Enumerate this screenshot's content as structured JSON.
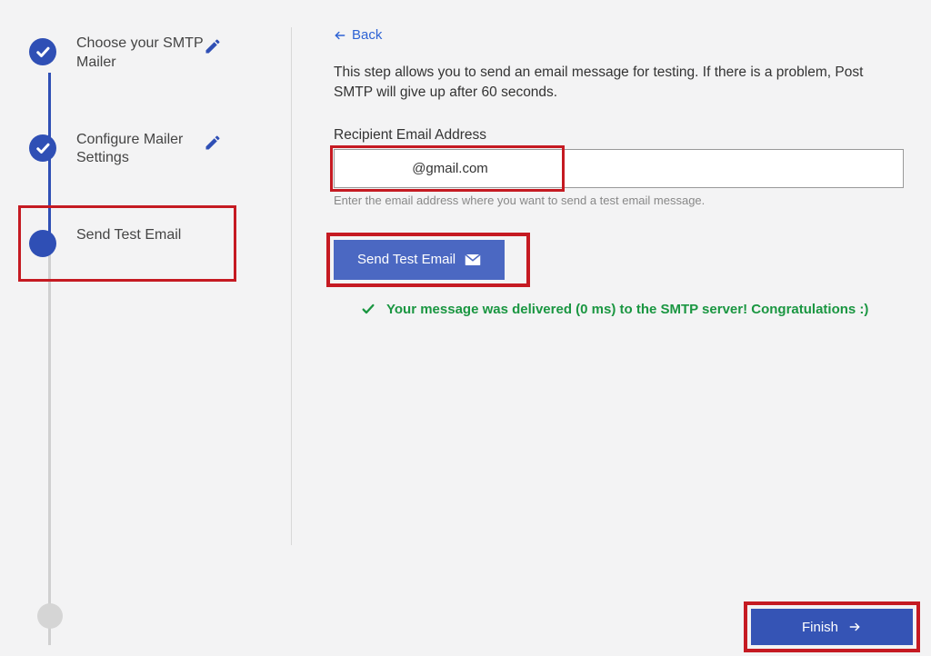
{
  "sidebar": {
    "steps": [
      {
        "label": "Choose your SMTP Mailer",
        "editable": true,
        "completed": true
      },
      {
        "label": "Configure Mailer Settings",
        "editable": true,
        "completed": true
      },
      {
        "label": "Send Test Email",
        "editable": false,
        "completed": false,
        "current": true
      }
    ]
  },
  "main": {
    "back_label": "Back",
    "description": "This step allows you to send an email message for testing. If there is a problem, Post SMTP will give up after 60 seconds.",
    "field_label": "Recipient Email Address",
    "input_value": "@gmail.com",
    "helper_text": "Enter the email address where you want to send a test email message.",
    "send_button_label": "Send Test Email",
    "success_message": "Your message was delivered (0 ms) to the SMTP server! Congratulations :)"
  },
  "footer": {
    "finish_label": "Finish"
  },
  "colors": {
    "primary": "#3554b5",
    "success": "#1a9641",
    "highlight": "#c51a22"
  }
}
